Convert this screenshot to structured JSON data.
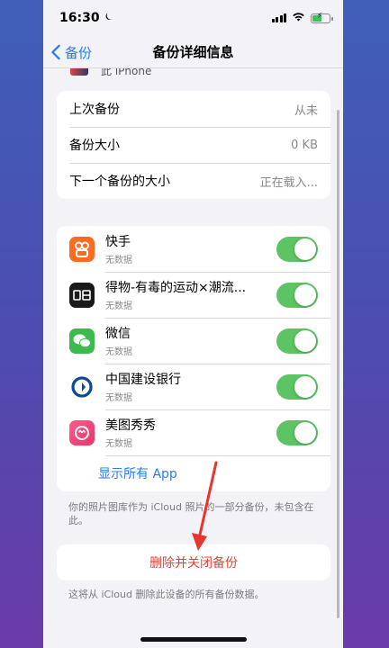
{
  "status_bar": {
    "time": "16:30"
  },
  "nav": {
    "back_label": "备份",
    "title": "备份详细信息"
  },
  "device": {
    "label": "此 iPhone"
  },
  "backup_info": [
    {
      "label": "上次备份",
      "value": "从未"
    },
    {
      "label": "备份大小",
      "value": "0 KB"
    },
    {
      "label": "下一个备份的大小",
      "value": "正在载入..."
    }
  ],
  "apps": [
    {
      "name": "快手",
      "sub": "无数据",
      "icon": "kuaishou-icon",
      "enabled": true
    },
    {
      "name": "得物-有毒的运动×潮流...",
      "sub": "无数据",
      "icon": "dewu-icon",
      "enabled": true
    },
    {
      "name": "微信",
      "sub": "无数据",
      "icon": "wechat-icon",
      "enabled": true
    },
    {
      "name": "中国建设银行",
      "sub": "无数据",
      "icon": "ccb-icon",
      "enabled": true
    },
    {
      "name": "美图秀秀",
      "sub": "无数据",
      "icon": "meitu-icon",
      "enabled": true
    }
  ],
  "show_all_label": "显示所有 App",
  "photo_note": "你的照片图库作为 iCloud 照片的一部分备份，未包含在此。",
  "delete_label": "删除并关闭备份",
  "delete_note": "这将从 iCloud 删除此设备的所有备份数据。",
  "colors": {
    "accent": "#2a7af5",
    "toggle_on": "#5cc463",
    "destructive": "#e0443a",
    "annotation_arrow": "#e8352e"
  }
}
